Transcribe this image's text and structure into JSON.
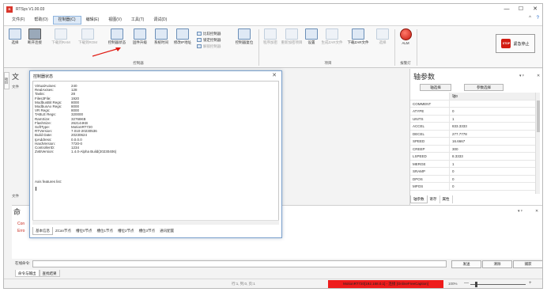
{
  "window": {
    "title": "RTSys V1.00.03",
    "app_icon_text": "R",
    "controls": {
      "minimize": "—",
      "maximize": "☐",
      "close": "✕"
    }
  },
  "menu": {
    "items": [
      "文件(F)",
      "帮助(O)",
      "控制器(C)",
      "编辑(E)",
      "视图(V)",
      "工具(T)",
      "调试(D)"
    ],
    "active_index": 2,
    "help_icon": "?",
    "collapse_icon": "^"
  },
  "ribbon": {
    "buttons": {
      "select": "选择",
      "disconnect": "断开连接",
      "download_ram": "下载到RAM",
      "download_rom": "下载到ROM",
      "controller_status": "控制器状态",
      "firmware_upgrade": "固件升级",
      "system_time": "系统时间",
      "modify_ip": "修改IP地址",
      "controller_reset": "控制器复位",
      "encrypt": "程序加密",
      "reset_project": "重新加密项目",
      "settings": "设置",
      "generate_zar": "生成ZAR文件",
      "download_zar": "下载ZAR文件",
      "select2": "选择",
      "alm": "ALM",
      "estop": "紧急停止",
      "stop_sign": "STOP"
    },
    "list": {
      "compare": "比较控制器",
      "lock": "锁定控制器",
      "unlock": "解锁控制器"
    },
    "groups": {
      "controller": "控制器",
      "project": "项目",
      "alarm": "报警灯"
    }
  },
  "left_panel": {
    "vtab": "项目",
    "title": "文",
    "sub": "文件",
    "bottom": "文件"
  },
  "axis_panel": {
    "title": "轴参数",
    "ctl": {
      "pin": "▾ ᵖ",
      "close": "✕"
    },
    "buttons": {
      "axis_select": "轴选择",
      "param_select": "参数选择"
    },
    "header": "轴0",
    "params": [
      {
        "name": "COMMENT",
        "value": ""
      },
      {
        "name": "ATYPE",
        "value": "0"
      },
      {
        "name": "UNITS",
        "value": "1"
      },
      {
        "name": "ACCEL",
        "value": "833.3333"
      },
      {
        "name": "DECEL",
        "value": "277.7778"
      },
      {
        "name": "SPEED",
        "value": "16.6667"
      },
      {
        "name": "CREEP",
        "value": "300"
      },
      {
        "name": "LSPEED",
        "value": "8.3333"
      },
      {
        "name": "MERGE",
        "value": "1"
      },
      {
        "name": "SRAMP",
        "value": "0"
      },
      {
        "name": "DPOS",
        "value": "0"
      },
      {
        "name": "MPOS",
        "value": "0"
      }
    ],
    "tabs": [
      "轴参数",
      "寄存",
      "属性"
    ]
  },
  "dialog": {
    "title": "控制器状态",
    "close": "✕",
    "info": [
      {
        "k": "VirtualAxises:",
        "v": "240"
      },
      {
        "k": "RealAxises:",
        "v": "128"
      },
      {
        "k": "Tasks:",
        "v": "28"
      },
      {
        "k": "Files3File:",
        "v": "1920"
      },
      {
        "k": "ModbusBit Regs:",
        "v": "8000"
      },
      {
        "k": "ModbusAx Regs:",
        "v": "8000"
      },
      {
        "k": "VR Regs:",
        "v": "8000"
      },
      {
        "k": "TABLE Regs:",
        "v": "320000"
      },
      {
        "k": "RamSize:",
        "v": "32768KB"
      },
      {
        "k": "FlashSize:",
        "v": "262144KB"
      },
      {
        "k": "SoftType:",
        "v": "MotionRT720"
      },
      {
        "k": "RTVersion:",
        "v": "7.010-20230536"
      },
      {
        "k": "Build Date:",
        "v": "20230624"
      },
      {
        "k": "IpAddress:",
        "v": "0.0.0.0"
      },
      {
        "k": "HardVersion:",
        "v": "7720-0"
      },
      {
        "k": "ControllerID:",
        "v": "1234"
      },
      {
        "k": "ZvBVersion:",
        "v": "1.4.0-Alpha Build(20230406)"
      }
    ],
    "axis_features": "Axis features list:",
    "tabs": [
      "基本信息",
      "ZCan节点",
      "槽位0节点",
      "槽位1节点",
      "槽位2节点",
      "槽位3节点",
      "通讯配置"
    ]
  },
  "command": {
    "title": "命",
    "ctl": {
      "pin": "▾ ᵖ",
      "close": "✕"
    },
    "lines": [
      "Con",
      "Erro"
    ],
    "input_label": "在线命令:",
    "buttons": {
      "send": "发送",
      "clear": "清除",
      "capture": "捕获"
    },
    "tabs": [
      "命令与输出",
      "查找结果"
    ]
  },
  "status": {
    "cursor": "行:1, 列:0, 页:1 ",
    "connection": "MotionRT720[192.168.0.1] - 连接 [OnlineFreeCaption]",
    "zoom": "100%",
    "zoom_minus": "—",
    "zoom_plus": "+"
  },
  "colors": {
    "accent": "#1a64c8",
    "alarm_red": "#d21d12",
    "status_red": "#ee1c1c",
    "dialog_border": "#7aa0cc"
  }
}
